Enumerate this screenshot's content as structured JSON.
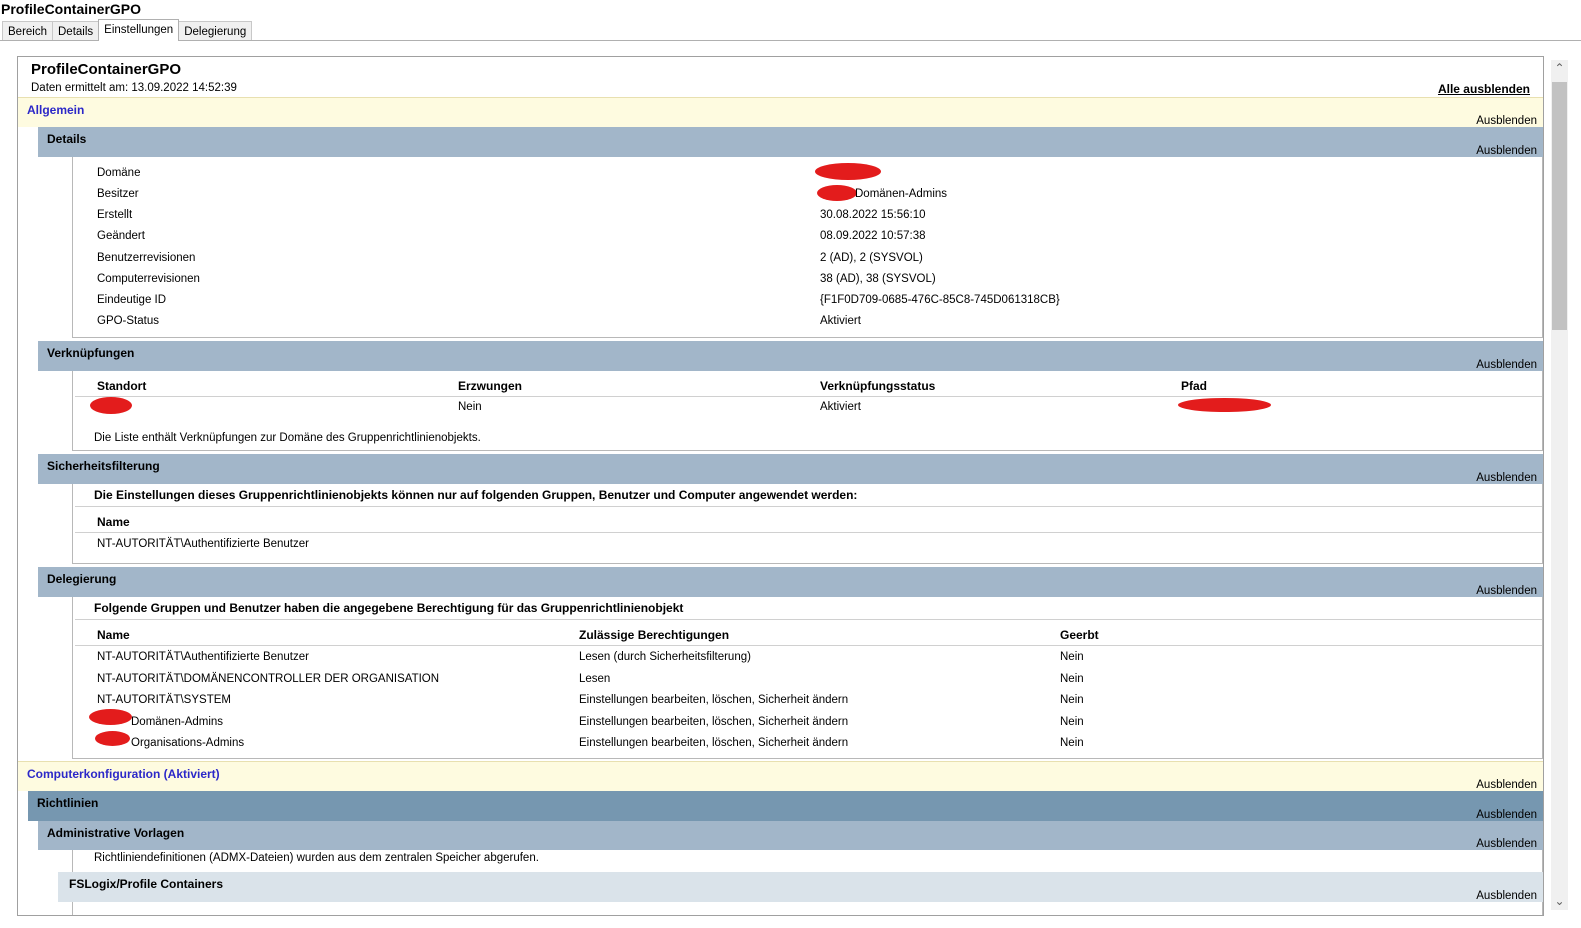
{
  "window": {
    "title": "ProfileContainerGPO"
  },
  "tabs": [
    "Bereich",
    "Details",
    "Einstellungen",
    "Delegierung"
  ],
  "report": {
    "title": "ProfileContainerGPO",
    "date": "Daten ermittelt am: 13.09.2022 14:52:39",
    "hide_all": "Alle ausblenden",
    "hide": "Ausblenden"
  },
  "general": {
    "title": "Allgemein"
  },
  "details": {
    "title": "Details",
    "rows": [
      {
        "label": "Domäne",
        "value": ""
      },
      {
        "label": "Besitzer",
        "value": "Domänen-Admins"
      },
      {
        "label": "Erstellt",
        "value": "30.08.2022 15:56:10"
      },
      {
        "label": "Geändert",
        "value": "08.09.2022 10:57:38"
      },
      {
        "label": "Benutzerrevisionen",
        "value": "2 (AD), 2 (SYSVOL)"
      },
      {
        "label": "Computerrevisionen",
        "value": "38 (AD), 38 (SYSVOL)"
      },
      {
        "label": "Eindeutige ID",
        "value": "{F1F0D709-0685-476C-85C8-745D061318CB}"
      },
      {
        "label": "GPO-Status",
        "value": "Aktiviert"
      }
    ]
  },
  "links": {
    "title": "Verknüpfungen",
    "headers": [
      "Standort",
      "Erzwungen",
      "Verknüpfungsstatus",
      "Pfad"
    ],
    "rows": [
      {
        "location": "",
        "enforced": "Nein",
        "status": "Aktiviert",
        "path": ""
      }
    ],
    "note": "Die Liste enthält Verknüpfungen zur Domäne des Gruppenrichtlinienobjekts."
  },
  "security": {
    "title": "Sicherheitsfilterung",
    "note": "Die Einstellungen dieses Gruppenrichtlinienobjekts können nur auf folgenden Gruppen, Benutzer und Computer angewendet werden:",
    "header": "Name",
    "rows": [
      "NT-AUTORITÄT\\Authentifizierte Benutzer"
    ]
  },
  "delegation": {
    "title": "Delegierung",
    "note": "Folgende Gruppen und Benutzer haben die angegebene Berechtigung für das Gruppenrichtlinienobjekt",
    "headers": [
      "Name",
      "Zulässige Berechtigungen",
      "Geerbt"
    ],
    "rows": [
      {
        "name": "NT-AUTORITÄT\\Authentifizierte Benutzer",
        "perm": "Lesen (durch Sicherheitsfilterung)",
        "inherited": "Nein"
      },
      {
        "name": "NT-AUTORITÄT\\DOMÄNENCONTROLLER DER ORGANISATION",
        "perm": "Lesen",
        "inherited": "Nein"
      },
      {
        "name": "NT-AUTORITÄT\\SYSTEM",
        "perm": "Einstellungen bearbeiten, löschen, Sicherheit ändern",
        "inherited": "Nein"
      },
      {
        "name": "Domänen-Admins",
        "perm": "Einstellungen bearbeiten, löschen, Sicherheit ändern",
        "inherited": "Nein"
      },
      {
        "name": "Organisations-Admins",
        "perm": "Einstellungen bearbeiten, löschen, Sicherheit ändern",
        "inherited": "Nein"
      }
    ]
  },
  "computer_config": {
    "title": "Computerkonfiguration (Aktiviert)"
  },
  "policies": {
    "title": "Richtlinien"
  },
  "admin_templates": {
    "title": "Administrative Vorlagen",
    "note": "Richtliniendefinitionen (ADMX-Dateien) wurden aus dem zentralen Speicher abgerufen."
  },
  "fslogix": {
    "title": "FSLogix/Profile Containers"
  },
  "colors": {
    "yellow_band": "#fefbe0",
    "blue_band": "#a2b6c9",
    "dark_blue_band": "#7697b0",
    "light_band": "#dae3ea",
    "link_color": "#2c28c8",
    "redaction": "#e31c1c"
  },
  "icons": [
    "scroll-up-icon",
    "scroll-down-icon"
  ]
}
